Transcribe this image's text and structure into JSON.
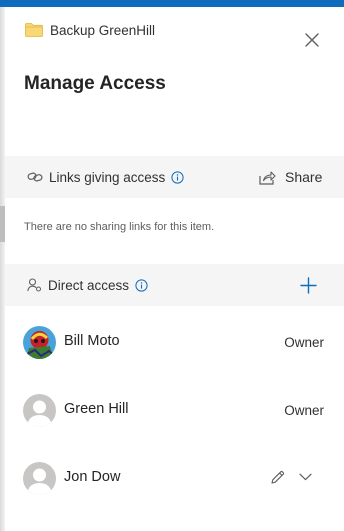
{
  "header": {
    "breadcrumb": "Backup GreenHill",
    "title": "Manage Access",
    "folder_icon": "folder-icon",
    "close_icon": "close-icon"
  },
  "links_section": {
    "label": "Links giving access",
    "share_label": "Share",
    "empty_message": "There are no sharing links for this item."
  },
  "direct_section": {
    "label": "Direct access",
    "add_icon": "plus-icon"
  },
  "people": [
    {
      "name": "Bill Moto",
      "role": "Owner",
      "avatar": "photo-avatar"
    },
    {
      "name": "Green Hill",
      "role": "Owner",
      "avatar": "placeholder-avatar"
    },
    {
      "name": "Jon Dow",
      "role": "",
      "avatar": "placeholder-avatar"
    }
  ],
  "colors": {
    "accent": "#0f6cbd",
    "section_bg": "#f5f5f5",
    "folder": "#f8d775",
    "avatar_placeholder": "#c8c6c4"
  }
}
